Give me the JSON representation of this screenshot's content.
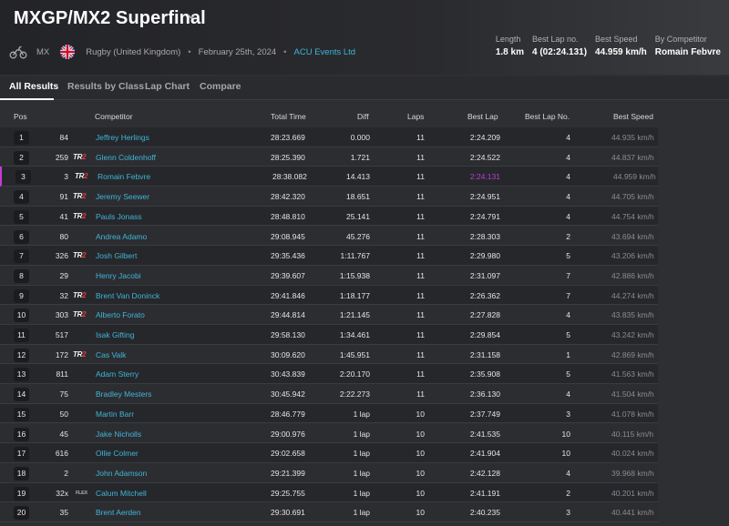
{
  "header": {
    "title": "MXGP/MX2 Superfinal",
    "discipline": "MX",
    "venue": "Rugby (United Kingdom)",
    "date": "February 25th, 2024",
    "organizer": "ACU Events Ltd",
    "stats": [
      {
        "label": "Length",
        "value": "1.8 km"
      },
      {
        "label": "Best Lap no.",
        "value": "4 (02:24.131)"
      },
      {
        "label": "Best Speed",
        "value": "44.959 km/h"
      },
      {
        "label": "By Competitor",
        "value": "Romain Febvre"
      }
    ]
  },
  "tabs": [
    "All Results",
    "Results by Class",
    "Lap Chart",
    "Compare"
  ],
  "columns": {
    "pos": "Pos",
    "competitor": "Competitor",
    "total": "Total Time",
    "diff": "Diff",
    "laps": "Laps",
    "best_lap": "Best Lap",
    "best_lap_no": "Best Lap No.",
    "best_speed": "Best Speed"
  },
  "rows": [
    {
      "pos": "1",
      "num": "84",
      "team": "",
      "name": "Jeffrey Herlings",
      "total": "28:23.669",
      "diff": "0.000",
      "laps": "11",
      "best_lap": "2:24.209",
      "best_lap_no": "4",
      "speed": "44.935 km/h"
    },
    {
      "pos": "2",
      "num": "259",
      "team": "TR",
      "name": "Glenn Coldenhoff",
      "total": "28:25.390",
      "diff": "1.721",
      "laps": "11",
      "best_lap": "2:24.522",
      "best_lap_no": "4",
      "speed": "44.837 km/h"
    },
    {
      "pos": "3",
      "num": "3",
      "team": "TR",
      "name": "Romain Febvre",
      "total": "28:38.082",
      "diff": "14.413",
      "laps": "11",
      "best_lap": "2:24.131",
      "best_lap_no": "4",
      "speed": "44.959 km/h"
    },
    {
      "pos": "4",
      "num": "91",
      "team": "TR",
      "name": "Jeremy Seewer",
      "total": "28:42.320",
      "diff": "18.651",
      "laps": "11",
      "best_lap": "2:24.951",
      "best_lap_no": "4",
      "speed": "44.705 km/h"
    },
    {
      "pos": "5",
      "num": "41",
      "team": "TR",
      "name": "Pauls Jonass",
      "total": "28:48.810",
      "diff": "25.141",
      "laps": "11",
      "best_lap": "2:24.791",
      "best_lap_no": "4",
      "speed": "44.754 km/h"
    },
    {
      "pos": "6",
      "num": "80",
      "team": "",
      "name": "Andrea Adamo",
      "total": "29:08.945",
      "diff": "45.276",
      "laps": "11",
      "best_lap": "2:28.303",
      "best_lap_no": "2",
      "speed": "43.694 km/h"
    },
    {
      "pos": "7",
      "num": "326",
      "team": "TR",
      "name": "Josh Gilbert",
      "total": "29:35.436",
      "diff": "1:11.767",
      "laps": "11",
      "best_lap": "2:29.980",
      "best_lap_no": "5",
      "speed": "43.206 km/h"
    },
    {
      "pos": "8",
      "num": "29",
      "team": "",
      "name": "Henry Jacobi",
      "total": "29:39.607",
      "diff": "1:15.938",
      "laps": "11",
      "best_lap": "2:31.097",
      "best_lap_no": "7",
      "speed": "42.886 km/h"
    },
    {
      "pos": "9",
      "num": "32",
      "team": "TR",
      "name": "Brent Van Doninck",
      "total": "29:41.846",
      "diff": "1:18.177",
      "laps": "11",
      "best_lap": "2:26.362",
      "best_lap_no": "7",
      "speed": "44.274 km/h"
    },
    {
      "pos": "10",
      "num": "303",
      "team": "TR",
      "name": "Alberto Forato",
      "total": "29:44.814",
      "diff": "1:21.145",
      "laps": "11",
      "best_lap": "2:27.828",
      "best_lap_no": "4",
      "speed": "43.835 km/h"
    },
    {
      "pos": "11",
      "num": "517",
      "team": "",
      "name": "Isak Gifting",
      "total": "29:58.130",
      "diff": "1:34.461",
      "laps": "11",
      "best_lap": "2:29.854",
      "best_lap_no": "5",
      "speed": "43.242 km/h"
    },
    {
      "pos": "12",
      "num": "172",
      "team": "TR",
      "name": "Cas Valk",
      "total": "30:09.620",
      "diff": "1:45.951",
      "laps": "11",
      "best_lap": "2:31.158",
      "best_lap_no": "1",
      "speed": "42.869 km/h"
    },
    {
      "pos": "13",
      "num": "811",
      "team": "",
      "name": "Adam Sterry",
      "total": "30:43.839",
      "diff": "2:20.170",
      "laps": "11",
      "best_lap": "2:35.908",
      "best_lap_no": "5",
      "speed": "41.563 km/h"
    },
    {
      "pos": "14",
      "num": "75",
      "team": "",
      "name": "Bradley Mesters",
      "total": "30:45.942",
      "diff": "2:22.273",
      "laps": "11",
      "best_lap": "2:36.130",
      "best_lap_no": "4",
      "speed": "41.504 km/h"
    },
    {
      "pos": "15",
      "num": "50",
      "team": "",
      "name": "Martin Barr",
      "total": "28:46.779",
      "diff": "1 lap",
      "laps": "10",
      "best_lap": "2:37.749",
      "best_lap_no": "3",
      "speed": "41.078 km/h"
    },
    {
      "pos": "16",
      "num": "45",
      "team": "",
      "name": "Jake Nicholls",
      "total": "29:00.976",
      "diff": "1 lap",
      "laps": "10",
      "best_lap": "2:41.535",
      "best_lap_no": "10",
      "speed": "40.115 km/h"
    },
    {
      "pos": "17",
      "num": "616",
      "team": "",
      "name": "Ollie Colmer",
      "total": "29:02.658",
      "diff": "1 lap",
      "laps": "10",
      "best_lap": "2:41.904",
      "best_lap_no": "10",
      "speed": "40.024 km/h"
    },
    {
      "pos": "18",
      "num": "2",
      "team": "",
      "name": "John Adamson",
      "total": "29:21.399",
      "diff": "1 lap",
      "laps": "10",
      "best_lap": "2:42.128",
      "best_lap_no": "4",
      "speed": "39.968 km/h"
    },
    {
      "pos": "19",
      "num": "32x",
      "team": "FLEX",
      "name": "Calum Mitchell",
      "total": "29:25.755",
      "diff": "1 lap",
      "laps": "10",
      "best_lap": "2:41.191",
      "best_lap_no": "2",
      "speed": "40.201 km/h"
    },
    {
      "pos": "20",
      "num": "35",
      "team": "",
      "name": "Brent Aerden",
      "total": "29:30.691",
      "diff": "1 lap",
      "laps": "10",
      "best_lap": "2:40.235",
      "best_lap_no": "3",
      "speed": "40.441 km/h"
    }
  ],
  "colors": {
    "accent": "#3fb6d8",
    "best_lap_highlight": "#b93fd6",
    "team_tag_red": "#e23b3b"
  }
}
